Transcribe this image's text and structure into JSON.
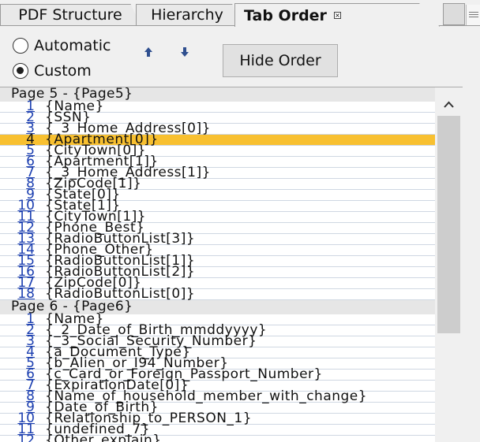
{
  "tabs": [
    {
      "label": "PDF Structure"
    },
    {
      "label": "Hierarchy"
    },
    {
      "label": "Tab Order"
    }
  ],
  "close_glyph": "×",
  "options": {
    "automatic_label": "Automatic",
    "custom_label": "Custom",
    "selected": "custom"
  },
  "hide_order_label": "Hide Order",
  "groups": [
    {
      "header": "Page 5 - {Page5}",
      "rows": [
        {
          "num": "1",
          "field": "{Name}"
        },
        {
          "num": "2",
          "field": "{SSN}"
        },
        {
          "num": "3",
          "field": "{_3_Home_Address[0]}"
        },
        {
          "num": "4",
          "field": "{Apartment[0]}",
          "selected": true
        },
        {
          "num": "5",
          "field": "{CityTown[0]}"
        },
        {
          "num": "6",
          "field": "{Apartment[1]}"
        },
        {
          "num": "7",
          "field": "{_3_Home_Address[1]}"
        },
        {
          "num": "8",
          "field": "{ZipCode[1]}"
        },
        {
          "num": "9",
          "field": "{State[0]}"
        },
        {
          "num": "10",
          "field": "{State[1]}"
        },
        {
          "num": "11",
          "field": "{CityTown[1]}"
        },
        {
          "num": "12",
          "field": "{Phone_Best}"
        },
        {
          "num": "13",
          "field": "{RadioButtonList[3]}"
        },
        {
          "num": "14",
          "field": "{Phone_Other}"
        },
        {
          "num": "15",
          "field": "{RadioButtonList[1]}"
        },
        {
          "num": "16",
          "field": "{RadioButtonList[2]}"
        },
        {
          "num": "17",
          "field": "{ZipCode[0]}"
        },
        {
          "num": "18",
          "field": "{RadioButtonList[0]}"
        }
      ]
    },
    {
      "header": "Page 6 - {Page6}",
      "rows": [
        {
          "num": "1",
          "field": "{Name}"
        },
        {
          "num": "2",
          "field": "{_2_Date_of_Birth_mmddyyyy}"
        },
        {
          "num": "3",
          "field": "{_3_Social_Security_Number}"
        },
        {
          "num": "4",
          "field": "{a_Document_Type}"
        },
        {
          "num": "5",
          "field": "{b_Alien_or_I94_Number}"
        },
        {
          "num": "6",
          "field": "{c_Card_or_Foreign_Passport_Number}"
        },
        {
          "num": "7",
          "field": "{ExpirationDate[0]}"
        },
        {
          "num": "8",
          "field": "{Name_of_household_member_with_change}"
        },
        {
          "num": "9",
          "field": "{Date_of_Birth}"
        },
        {
          "num": "10",
          "field": "{Relationship_to_PERSON_1}"
        },
        {
          "num": "11",
          "field": "{undefined_7}"
        },
        {
          "num": "12",
          "field": "{Other_explain}"
        }
      ]
    }
  ],
  "icons": {
    "move_up": "arrow-up-icon",
    "move_down": "arrow-down-icon",
    "scroll_up": "chevron-up-icon"
  },
  "colors": {
    "selection": "#f8c030",
    "row_number": "#1c3fb0",
    "arrow": "#2f4f8f"
  }
}
